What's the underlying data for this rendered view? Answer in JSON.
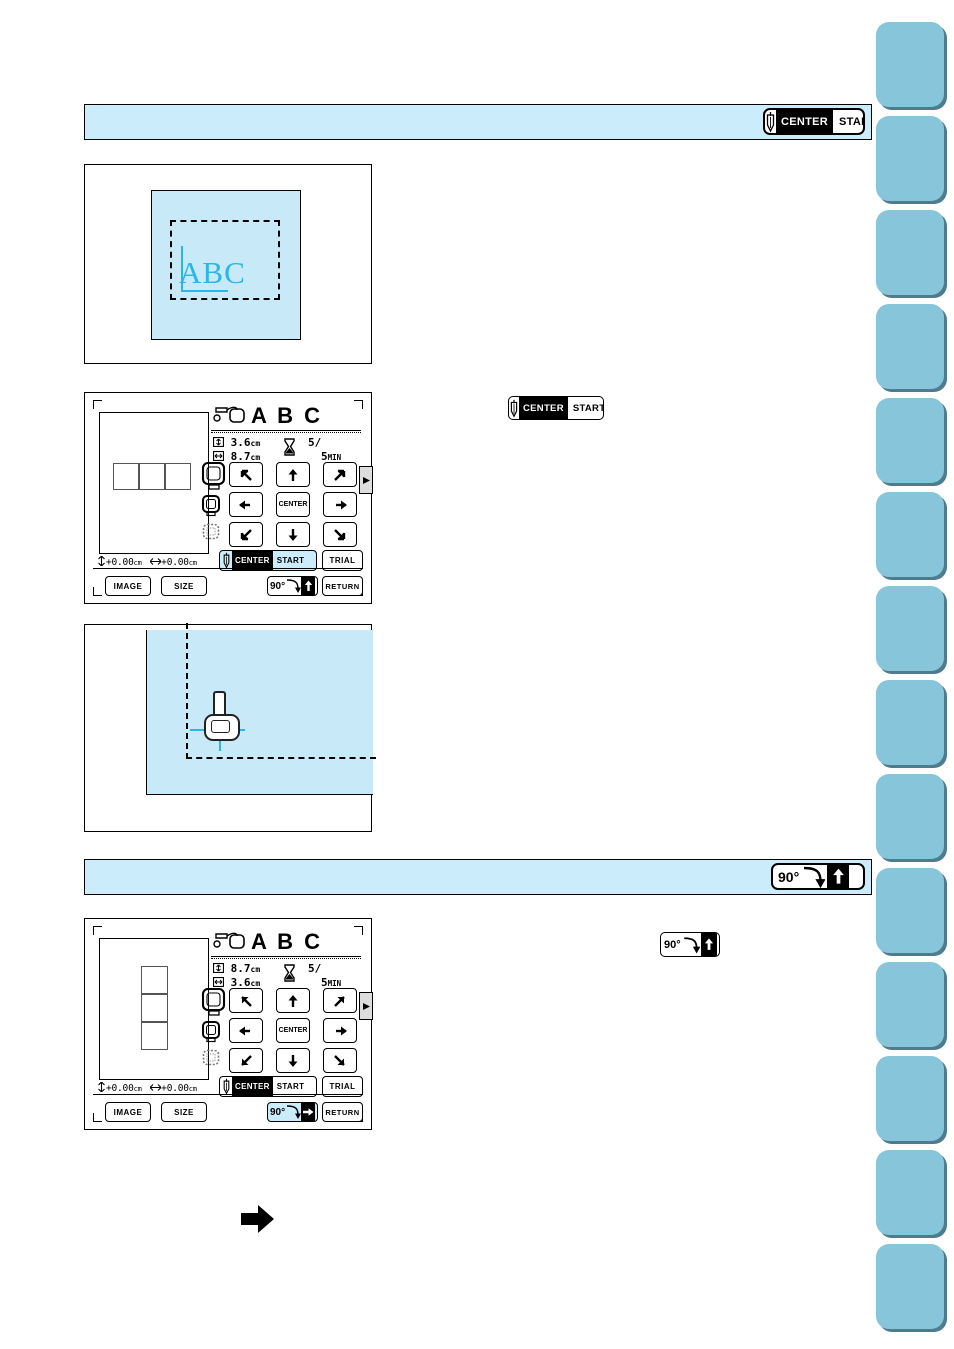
{
  "theme": {
    "fabric_blue": "#c8eaf8",
    "banner_blue": "#cbecfa",
    "tab_blue": "#86c5da",
    "tab_shadow": "#4e7c8c",
    "stitch_cyan": "#29b6e8",
    "black": "#000000"
  },
  "sidebar": {
    "tab_count": 14,
    "tabs": [
      {
        "label": ""
      },
      {
        "label": ""
      },
      {
        "label": ""
      },
      {
        "label": ""
      },
      {
        "label": ""
      },
      {
        "label": ""
      },
      {
        "label": ""
      },
      {
        "label": ""
      },
      {
        "label": ""
      },
      {
        "label": ""
      },
      {
        "label": ""
      },
      {
        "label": ""
      },
      {
        "label": ""
      },
      {
        "label": ""
      }
    ]
  },
  "sections": [
    {
      "id": "center-start-section",
      "banner_button": {
        "needle_icon": "needle-icon",
        "center_label": "CENTER",
        "start_label": "START",
        "center_highlighted": true
      }
    },
    {
      "id": "rotate-section",
      "banner_button": {
        "degree_label": "90°",
        "curve_icon": "rotate-curve-icon",
        "arrow_icon": "arrow-up-icon"
      }
    }
  ],
  "figures": {
    "fabric_with_frame": {
      "name": "fabric-with-embroidery-frame",
      "artwork_text": "ABC",
      "frame_style": "dashed"
    },
    "presser_foot_closeup": {
      "name": "presser-foot-at-corner",
      "foot_icon": "presser-foot-icon",
      "crosshair_icon": "crosshair-icon"
    }
  },
  "inline_buttons": {
    "center_start": {
      "needle_icon": "needle-icon",
      "center_label": "CENTER",
      "start_label": "START"
    },
    "rotate": {
      "degree_label": "90°",
      "curve_icon": "rotate-curve-icon",
      "arrow_icon": "arrow-up-icon"
    }
  },
  "big_arrow": {
    "icon": "arrow-right-icon"
  },
  "screens": [
    {
      "id": "lcd-before-rotate",
      "design_title": "A B C",
      "design_icon": "pattern-icon",
      "height_icon": "height-icon",
      "height_value": "3.6",
      "height_unit": "cm",
      "width_icon": "width-icon",
      "width_value": "8.7",
      "width_unit": "cm",
      "time_icon": "hourglass-icon",
      "stitch_count": "5",
      "slash": "/",
      "minutes_value": "5",
      "minutes_unit": "MIN",
      "preview_orientation": "horizontal",
      "preview_cells": 3,
      "coord_v_icon": "vertical-arrow-icon",
      "coord_v_value": "+0.00",
      "coord_h_icon": "horizontal-arrow-icon",
      "coord_h_value": "+0.00",
      "coord_unit": "cm",
      "hoop_icons": [
        "hoop-large-icon",
        "hoop-medium-icon",
        "hoop-small-icon"
      ],
      "side_tab_icon": "next-page-icon",
      "keys": [
        {
          "name": "move-up-left-key",
          "icon": "arrow-up-left-icon",
          "label": ""
        },
        {
          "name": "move-up-key",
          "icon": "arrow-up-icon",
          "label": ""
        },
        {
          "name": "move-up-right-key",
          "icon": "arrow-up-right-icon",
          "label": ""
        },
        {
          "name": "move-left-key",
          "icon": "arrow-left-icon",
          "label": ""
        },
        {
          "name": "center-key",
          "icon": "center-icon",
          "label": "CENTER"
        },
        {
          "name": "move-right-key",
          "icon": "arrow-right-icon",
          "label": ""
        },
        {
          "name": "move-down-left-key",
          "icon": "arrow-down-left-icon",
          "label": ""
        },
        {
          "name": "move-down-key",
          "icon": "arrow-down-icon",
          "label": ""
        },
        {
          "name": "move-down-right-key",
          "icon": "arrow-down-right-icon",
          "label": ""
        }
      ],
      "center_start_button": {
        "needle_icon": "needle-icon",
        "center_label": "CENTER",
        "start_label": "START",
        "selected": true
      },
      "trial_label": "TRIAL",
      "image_label": "IMAGE",
      "size_label": "SIZE",
      "return_label": "RETURN",
      "rotate_button": {
        "degree_label": "90°",
        "curve_icon": "rotate-curve-icon",
        "arrow_icon": "arrow-up-icon",
        "selected": false
      }
    },
    {
      "id": "lcd-after-rotate",
      "design_title": "A B C",
      "design_icon": "pattern-icon",
      "height_icon": "height-icon",
      "height_value": "8.7",
      "height_unit": "cm",
      "width_icon": "width-icon",
      "width_value": "3.6",
      "width_unit": "cm",
      "time_icon": "hourglass-icon",
      "stitch_count": "5",
      "slash": "/",
      "minutes_value": "5",
      "minutes_unit": "MIN",
      "preview_orientation": "vertical",
      "preview_cells": 3,
      "coord_v_icon": "vertical-arrow-icon",
      "coord_v_value": "+0.00",
      "coord_h_icon": "horizontal-arrow-icon",
      "coord_h_value": "+0.00",
      "coord_unit": "cm",
      "hoop_icons": [
        "hoop-large-icon",
        "hoop-medium-icon",
        "hoop-small-icon"
      ],
      "side_tab_icon": "next-page-icon",
      "keys": [
        {
          "name": "move-up-left-key",
          "icon": "arrow-up-left-icon",
          "label": ""
        },
        {
          "name": "move-up-key",
          "icon": "arrow-up-icon",
          "label": ""
        },
        {
          "name": "move-up-right-key",
          "icon": "arrow-up-right-icon",
          "label": ""
        },
        {
          "name": "move-left-key",
          "icon": "arrow-left-icon",
          "label": ""
        },
        {
          "name": "center-key",
          "icon": "center-icon",
          "label": "CENTER"
        },
        {
          "name": "move-right-key",
          "icon": "arrow-right-icon",
          "label": ""
        },
        {
          "name": "move-down-left-key",
          "icon": "arrow-down-left-icon",
          "label": ""
        },
        {
          "name": "move-down-key",
          "icon": "arrow-down-icon",
          "label": ""
        },
        {
          "name": "move-down-right-key",
          "icon": "arrow-down-right-icon",
          "label": ""
        }
      ],
      "center_start_button": {
        "needle_icon": "needle-icon",
        "center_label": "CENTER",
        "start_label": "START",
        "selected": true
      },
      "trial_label": "TRIAL",
      "image_label": "IMAGE",
      "size_label": "SIZE",
      "return_label": "RETURN",
      "rotate_button": {
        "degree_label": "90°",
        "curve_icon": "rotate-curve-icon",
        "arrow_icon": "arrow-right-icon",
        "selected": true
      }
    }
  ]
}
